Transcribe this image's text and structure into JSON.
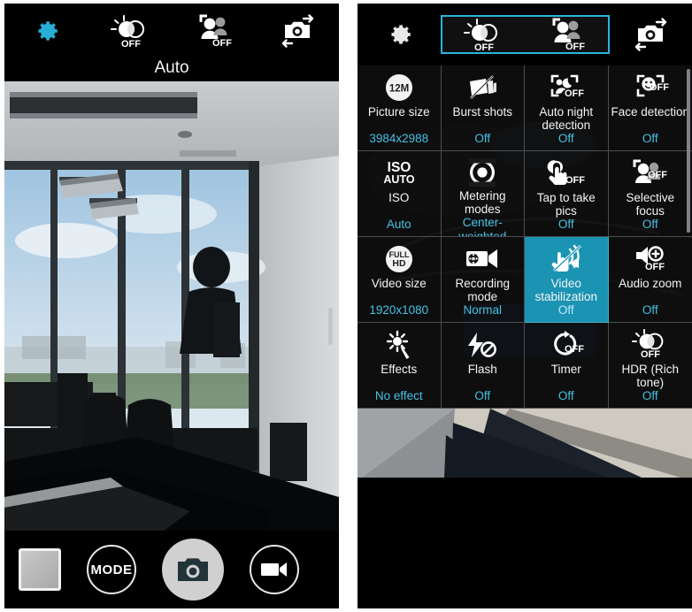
{
  "app": {
    "name": "Camera"
  },
  "left_panel": {
    "mode_label": "Auto",
    "toolbar": [
      {
        "name": "settings-gear",
        "icon": "gear-icon",
        "badge": "",
        "active": true
      },
      {
        "name": "hdr-toggle",
        "icon": "hdr-icon",
        "badge": "OFF",
        "active": false
      },
      {
        "name": "selfie-mode",
        "icon": "people-icon",
        "badge": "OFF",
        "active": false
      },
      {
        "name": "switch-camera",
        "icon": "camera-switch-icon",
        "badge": "",
        "active": false
      }
    ],
    "controls": {
      "thumbnail_label": "Gallery thumbnail",
      "mode_button": "MODE",
      "shutter_label": "Shutter",
      "video_label": "Record video"
    }
  },
  "right_panel": {
    "toolbar": [
      {
        "name": "settings-gear",
        "icon": "gear-icon",
        "badge": "",
        "highlighted": false
      },
      {
        "name": "hdr-toggle",
        "icon": "hdr-icon",
        "badge": "OFF",
        "highlighted": true
      },
      {
        "name": "selfie-mode",
        "icon": "people-icon",
        "badge": "OFF",
        "highlighted": true
      },
      {
        "name": "switch-camera",
        "icon": "camera-switch-icon",
        "badge": "",
        "highlighted": false
      }
    ],
    "settings": [
      {
        "icon": "picture-size-icon",
        "badge": "12M",
        "title": "Picture size",
        "value": "3984x2988",
        "selected": false
      },
      {
        "icon": "burst-shots-icon",
        "badge": "",
        "title": "Burst shots",
        "value": "Off",
        "selected": false
      },
      {
        "icon": "auto-night-icon",
        "badge": "OFF",
        "title": "Auto night detection",
        "value": "Off",
        "selected": false
      },
      {
        "icon": "face-detection-icon",
        "badge": "OFF",
        "title": "Face detection",
        "value": "Off",
        "selected": false
      },
      {
        "icon": "iso-icon",
        "badge": "AUTO",
        "title": "ISO",
        "value": "Auto",
        "selected": false
      },
      {
        "icon": "metering-modes-icon",
        "badge": "",
        "title": "Metering modes",
        "value": "Center-weighted",
        "selected": false
      },
      {
        "icon": "tap-to-take-pics-icon",
        "badge": "OFF",
        "title": "Tap to take pics",
        "value": "Off",
        "selected": false
      },
      {
        "icon": "selective-focus-icon",
        "badge": "OFF",
        "title": "Selective focus",
        "value": "Off",
        "selected": false
      },
      {
        "icon": "video-size-icon",
        "badge": "FULL HD",
        "title": "Video size",
        "value": "1920x1080",
        "selected": false
      },
      {
        "icon": "recording-mode-icon",
        "badge": "",
        "title": "Recording mode",
        "value": "Normal",
        "selected": false
      },
      {
        "icon": "video-stabilization-icon",
        "badge": "",
        "title": "Video stabilization",
        "value": "Off",
        "selected": true
      },
      {
        "icon": "audio-zoom-icon",
        "badge": "OFF",
        "title": "Audio zoom",
        "value": "Off",
        "selected": false
      },
      {
        "icon": "effects-icon",
        "badge": "",
        "title": "Effects",
        "value": "No effect",
        "selected": false
      },
      {
        "icon": "flash-icon",
        "badge": "",
        "title": "Flash",
        "value": "Off",
        "selected": false
      },
      {
        "icon": "timer-icon",
        "badge": "OFF",
        "title": "Timer",
        "value": "Off",
        "selected": false
      },
      {
        "icon": "hdr-rich-tone-icon",
        "badge": "OFF",
        "title": "HDR (Rich tone)",
        "value": "Off",
        "selected": false
      }
    ]
  },
  "colors": {
    "accent_cyan": "#46c2e4",
    "highlight_fill": "#1b94b4",
    "highlight_border": "#2ab4dd",
    "panel_black": "#000000",
    "text_white": "#f4f4f4"
  }
}
